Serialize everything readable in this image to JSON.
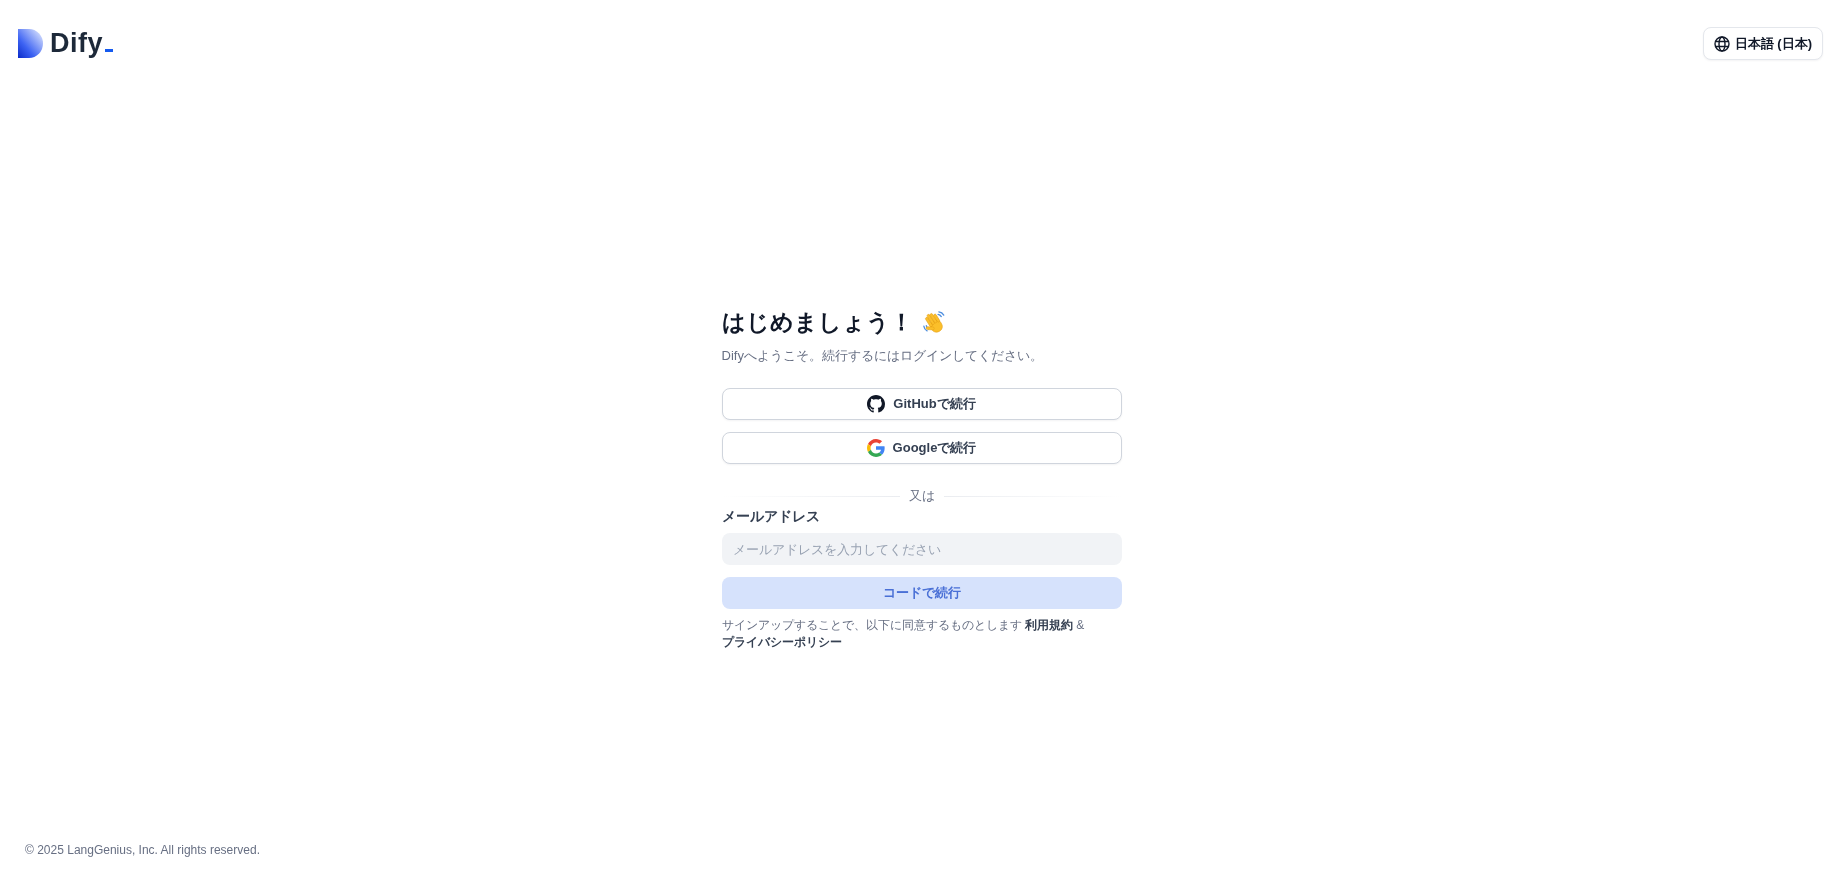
{
  "header": {
    "logo": {
      "text": "Dify"
    },
    "language_button": {
      "label": "日本語 (日本)"
    }
  },
  "login": {
    "title": "はじめましょう！",
    "subtitle": "Difyへようこそ。続行するにはログインしてください。",
    "oauth_buttons": [
      {
        "kind": "github",
        "label": "GitHubで続行"
      },
      {
        "kind": "google",
        "label": "Googleで続行"
      }
    ],
    "divider": "又は",
    "email": {
      "label": "メールアドレス",
      "placeholder": "メールアドレスを入力してください"
    },
    "submit": {
      "label": "コードで続行",
      "disabled": true
    },
    "terms": {
      "text": "サインアップすることで、以下に同意するものとします",
      "links": [
        "利用規約",
        "プライバシーポリシー"
      ],
      "separator": "&"
    }
  },
  "footer": {
    "copyright": "© 2025 LangGenius, Inc. All rights reserved."
  }
}
